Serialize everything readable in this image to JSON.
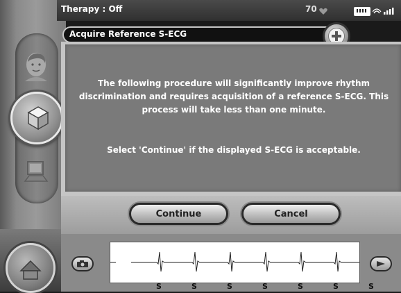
{
  "status": {
    "therapy": "Therapy : Off",
    "heart_rate": "70",
    "heart_icon": "heart-icon",
    "battery_icon": "battery-icon",
    "signal_icon": "signal-icon"
  },
  "title": "Acquire Reference S-ECG",
  "message": {
    "paragraph1": "The following procedure will significantly improve rhythm discrimination and requires acquisition of a reference S-ECG. This process will take less than one minute.",
    "paragraph2": "Select 'Continue' if the displayed S-ECG is acceptable."
  },
  "buttons": {
    "continue": "Continue",
    "cancel": "Cancel"
  },
  "nav": [
    {
      "icon": "patient-icon",
      "active": false
    },
    {
      "icon": "device-cube-icon",
      "active": true
    },
    {
      "icon": "computer-icon",
      "active": false
    },
    {
      "icon": "home-icon",
      "active": false
    }
  ],
  "ecg": {
    "markers": [
      "S",
      "S",
      "S",
      "S",
      "S",
      "S",
      "S"
    ],
    "capture_icon": "camera-icon",
    "next_icon": "arrow-icon"
  }
}
